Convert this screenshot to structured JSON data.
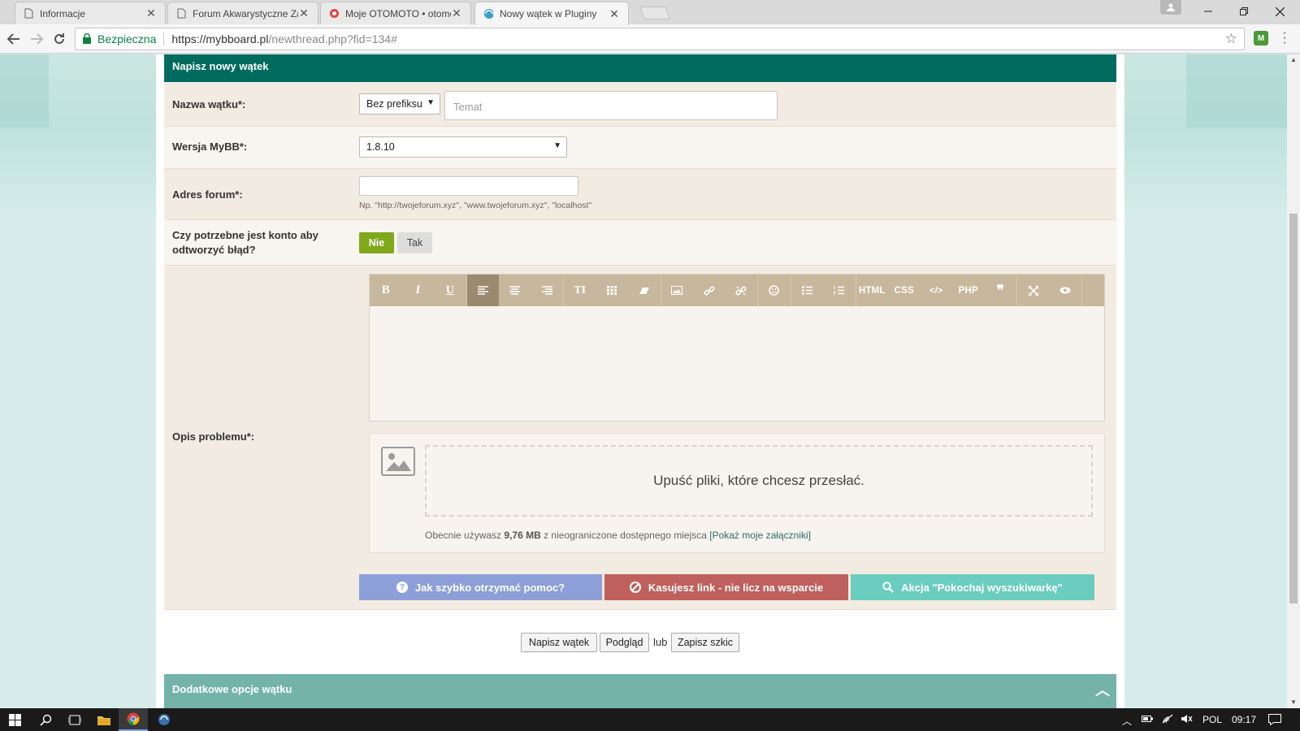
{
  "browser": {
    "tabs": [
      {
        "title": "Informacje",
        "icon": "document-icon",
        "active": false
      },
      {
        "title": "Forum Akwarystyczne Za",
        "icon": "document-icon",
        "active": false
      },
      {
        "title": "Moje OTOMOTO • otomo",
        "icon": "otomoto-icon",
        "active": false
      },
      {
        "title": "Nowy wątek w Pluginy",
        "icon": "mybb-icon",
        "active": true
      }
    ],
    "close_glyph": "✕",
    "security_label": "Bezpieczna",
    "url_host": "https://mybboard.pl",
    "url_path": "/newthread.php?fid=134#"
  },
  "form": {
    "header": "Napisz nowy wątek",
    "thread_name": {
      "label": "Nazwa wątku*:",
      "prefix_selected": "Bez prefiksu",
      "subject_placeholder": "Temat"
    },
    "mybb_version": {
      "label": "Wersja MyBB*:",
      "selected": "1.8.10"
    },
    "forum_address": {
      "label": "Adres forum*:",
      "value": "",
      "hint": "Np. \"http://twojeforum.xyz\", \"www.twojeforum.xyz\", \"localhost\""
    },
    "account_required": {
      "label": "Czy potrzebne jest konto aby odtworzyć błąd?",
      "options": [
        "Nie",
        "Tak"
      ],
      "selected": "Nie"
    },
    "description": {
      "label": "Opis problemu*:",
      "toolbar": [
        {
          "name": "bold",
          "glyph": "B"
        },
        {
          "name": "italic",
          "glyph": "I"
        },
        {
          "name": "underline",
          "glyph": "U"
        },
        {
          "name": "align-left",
          "glyph": "≡"
        },
        {
          "name": "align-center",
          "glyph": "≡"
        },
        {
          "name": "align-right",
          "glyph": "≡"
        },
        {
          "name": "font-size",
          "glyph": "TI"
        },
        {
          "name": "table",
          "glyph": "▦"
        },
        {
          "name": "eraser",
          "glyph": "◈"
        },
        {
          "name": "image",
          "glyph": "▣"
        },
        {
          "name": "link",
          "glyph": "∞"
        },
        {
          "name": "unlink",
          "glyph": "✂"
        },
        {
          "name": "emoticon",
          "glyph": "☺"
        },
        {
          "name": "bullet-list",
          "glyph": "☰"
        },
        {
          "name": "numbered-list",
          "glyph": "☰"
        },
        {
          "name": "html",
          "glyph": "HTML"
        },
        {
          "name": "css",
          "glyph": "CSS"
        },
        {
          "name": "code",
          "glyph": "</>"
        },
        {
          "name": "php",
          "glyph": "PHP"
        },
        {
          "name": "quote",
          "glyph": "❞"
        },
        {
          "name": "maximize",
          "glyph": "✥"
        },
        {
          "name": "preview",
          "glyph": "◉"
        }
      ],
      "editor_content": ""
    },
    "uploader": {
      "drop_text": "Upuść pliki, które chcesz przesłać.",
      "usage_prefix": "Obecnie używasz",
      "usage_amount": "9,76 MB",
      "usage_suffix": "z nieograniczone dostępnego miejsca",
      "attachments_link": "[Pokaż moje załączniki]"
    },
    "info_buttons": [
      {
        "label": "Jak szybko otrzymać pomoc?",
        "icon": "question-icon",
        "color": "#8d9fd9"
      },
      {
        "label": "Kasujesz link - nie licz na wsparcie",
        "icon": "ban-icon",
        "color": "#c0605c"
      },
      {
        "label": "Akcja \"Pokochaj wyszukiwarkę\"",
        "icon": "search-icon",
        "color": "#6bcdbf"
      }
    ],
    "submit": {
      "post_label": "Napisz wątek",
      "preview_label": "Podgląd",
      "or_text": "lub",
      "draft_label": "Zapisz szkic"
    },
    "extra_options_header": "Dodatkowe opcje wątku"
  },
  "taskbar": {
    "language": "POL",
    "time": "09:17"
  },
  "colors": {
    "header": "#006b5e",
    "row_odd": "#f2ebe1",
    "row_even": "#f8f4ef",
    "toolbar": "#c7b79d",
    "toggle_active": "#7fa81a"
  }
}
